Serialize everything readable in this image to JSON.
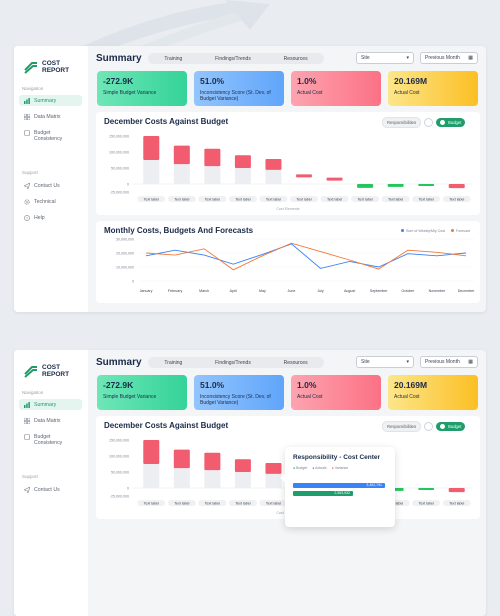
{
  "app": {
    "logo_line1": "COST",
    "logo_line2": "REPORT"
  },
  "sidebar": {
    "nav_heading": "Navigation",
    "items": [
      {
        "label": "Summary",
        "icon": "summary-icon",
        "active": true
      },
      {
        "label": "Data Matrix",
        "icon": "grid-icon",
        "active": false
      },
      {
        "label": "Budget Consistency",
        "icon": "budget-icon",
        "active": false
      }
    ],
    "support_heading": "Support",
    "support_items": [
      {
        "label": "Contact Us",
        "icon": "send-icon"
      },
      {
        "label": "Technical",
        "icon": "gear-icon"
      },
      {
        "label": "Help",
        "icon": "help-icon"
      }
    ]
  },
  "header": {
    "title": "Summary",
    "tabs": [
      "Training",
      "Findings/Trends",
      "Resources"
    ],
    "site_select": "Site",
    "month_select": "Previous Month"
  },
  "kpis": [
    {
      "value": "-272.9K",
      "label": "Simple Budget Variance"
    },
    {
      "value": "51.0%",
      "label": "Inconsistency Score (St. Dev. of Budget Variance)"
    },
    {
      "value": "1.0%",
      "label": "Actual Cost"
    },
    {
      "value": "20.169M",
      "label": "Actual Cost"
    }
  ],
  "toggles": {
    "left": "Responsibilities",
    "right": "Budget"
  },
  "tooltip": {
    "title": "Responsibility - Cost Center",
    "legend": [
      "Budget",
      "Actuals",
      "Variance"
    ],
    "bar1": "3,452,791",
    "bar2": "2,553,932"
  },
  "colors": {
    "green": "#1f9d6a",
    "blue": "#3b82f6",
    "red": "#f25c6f",
    "orange": "#f07a3a"
  },
  "chart_data": [
    {
      "type": "bar",
      "title": "December Costs Against Budget",
      "xlabel": "Cost Elements",
      "categories": [
        "Text label",
        "Text label",
        "Text label",
        "Text label",
        "Text label",
        "Text label",
        "Text label",
        "Text label",
        "Text label",
        "Text label",
        "Text label"
      ],
      "ytick_labels": [
        "150,000,000",
        "100,000,000",
        "50,000,000",
        "0",
        "-25,000,000"
      ],
      "ylim": [
        -25000000,
        150000000
      ],
      "series": [
        {
          "values": [
            150000000,
            120000000,
            110000000,
            90000000,
            78000000,
            30000000,
            20000000,
            -12000000,
            -9000000,
            -5000000,
            -13000000
          ]
        },
        {
          "values": [
            75000000,
            62000000,
            56000000,
            50000000,
            44000000,
            0,
            0,
            0,
            0,
            0,
            0
          ]
        }
      ]
    },
    {
      "type": "line",
      "title": "Monthly Costs, Budgets And Forecasts",
      "categories": [
        "January",
        "February",
        "March",
        "April",
        "May",
        "June",
        "July",
        "August",
        "September",
        "October",
        "November",
        "December"
      ],
      "ytick_labels": [
        "30,000,000",
        "20,000,000",
        "10,000,000",
        "0"
      ],
      "ylim": [
        0,
        30000000
      ],
      "legend": [
        "Sum of Weekly/Mly Cost",
        "Forecast"
      ],
      "series": [
        {
          "name": "Sum of Weekly/Mly Cost",
          "color": "#3b82f6",
          "values": [
            18000000,
            22000000,
            18500000,
            12000000,
            19000000,
            26500000,
            9000000,
            14000000,
            10000000,
            19500000,
            18000000,
            20000000
          ]
        },
        {
          "name": "Forecast",
          "color": "#f07a3a",
          "values": [
            20000000,
            18500000,
            23000000,
            8000000,
            18000000,
            27000000,
            21000000,
            15000000,
            8500000,
            22000000,
            20500000,
            18000000
          ]
        }
      ]
    }
  ]
}
